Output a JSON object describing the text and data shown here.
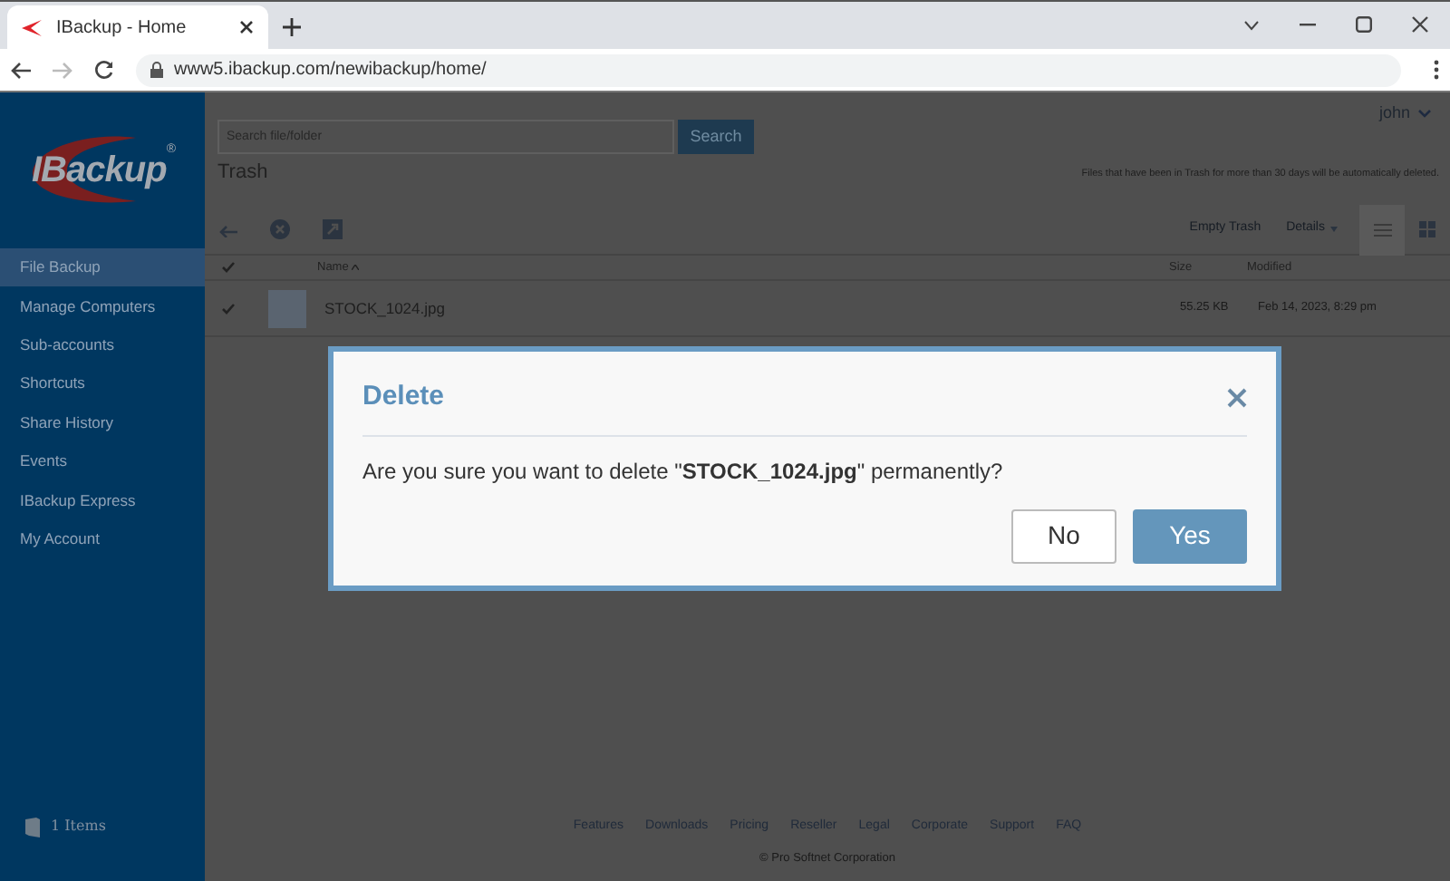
{
  "browser": {
    "tab_title": "IBackup - Home",
    "url": "www5.ibackup.com/newibackup/home/"
  },
  "logo": {
    "text": "IBackup",
    "mark": "®"
  },
  "sidebar": {
    "items": [
      {
        "label": "File Backup",
        "selected": true
      },
      {
        "label": "Manage Computers",
        "selected": false
      },
      {
        "label": "Sub-accounts",
        "selected": false
      },
      {
        "label": "Shortcuts",
        "selected": false
      },
      {
        "label": "Share History",
        "selected": false
      },
      {
        "label": "Events",
        "selected": false
      },
      {
        "label": "IBackup Express",
        "selected": false
      },
      {
        "label": "My Account",
        "selected": false
      }
    ],
    "items_count": "1 Items"
  },
  "user": "john",
  "search": {
    "placeholder": "Search file/folder",
    "button": "Search"
  },
  "page_title": "Trash",
  "notice": "Files that have been in Trash for more than 30 days will be automatically deleted.",
  "toolbar": {
    "empty_trash": "Empty Trash",
    "details": "Details"
  },
  "table": {
    "all_checked": true,
    "columns": [
      "Name",
      "Size",
      "Modified"
    ],
    "rows": [
      {
        "name": "STOCK_1024.jpg",
        "size": "55.25 KB",
        "modified": "Feb 14, 2023, 8:29 pm",
        "checked": true
      }
    ]
  },
  "footer": {
    "links": [
      "Features",
      "Downloads",
      "Pricing",
      "Reseller",
      "Legal",
      "Corporate",
      "Support",
      "FAQ"
    ],
    "copyright": "© Pro Softnet Corporation"
  },
  "dialog": {
    "title": "Delete",
    "message": "Are you sure you want to delete \"**STOCK_1024.jpg**\" permanently?",
    "buttons": [
      {
        "label": "No",
        "kind": "secondary"
      },
      {
        "label": "Yes",
        "kind": "primary"
      }
    ]
  }
}
